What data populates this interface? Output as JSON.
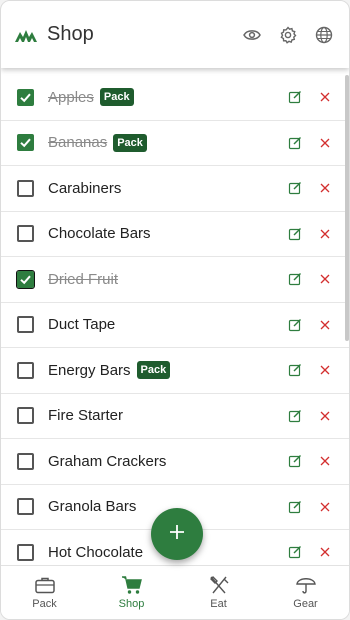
{
  "app": {
    "title": "Shop"
  },
  "colors": {
    "accent": "#2e7d3f",
    "badge": "#1f5c2e",
    "delete": "#d32f2f"
  },
  "header": {
    "actions": [
      {
        "name": "visibility-button",
        "icon": "eye-icon"
      },
      {
        "name": "settings-button",
        "icon": "gear-icon"
      },
      {
        "name": "language-button",
        "icon": "globe-icon"
      }
    ]
  },
  "items": [
    {
      "name": "Apples",
      "checked": true,
      "badge": "Pack"
    },
    {
      "name": "Bananas",
      "checked": true,
      "badge": "Pack"
    },
    {
      "name": "Carabiners",
      "checked": false,
      "badge": ""
    },
    {
      "name": "Chocolate Bars",
      "checked": false,
      "badge": ""
    },
    {
      "name": "Dried Fruit",
      "checked": true,
      "badge": "",
      "focused": true
    },
    {
      "name": "Duct Tape",
      "checked": false,
      "badge": ""
    },
    {
      "name": "Energy Bars",
      "checked": false,
      "badge": "Pack"
    },
    {
      "name": "Fire Starter",
      "checked": false,
      "badge": ""
    },
    {
      "name": "Graham Crackers",
      "checked": false,
      "badge": ""
    },
    {
      "name": "Granola Bars",
      "checked": false,
      "badge": ""
    },
    {
      "name": "Hot Chocolate",
      "checked": false,
      "badge": ""
    }
  ],
  "fab": {
    "icon": "plus-icon"
  },
  "nav": [
    {
      "label": "Pack",
      "icon": "briefcase-icon",
      "active": false
    },
    {
      "label": "Shop",
      "icon": "cart-icon",
      "active": true
    },
    {
      "label": "Eat",
      "icon": "utensils-icon",
      "active": false
    },
    {
      "label": "Gear",
      "icon": "umbrella-icon",
      "active": false
    }
  ]
}
